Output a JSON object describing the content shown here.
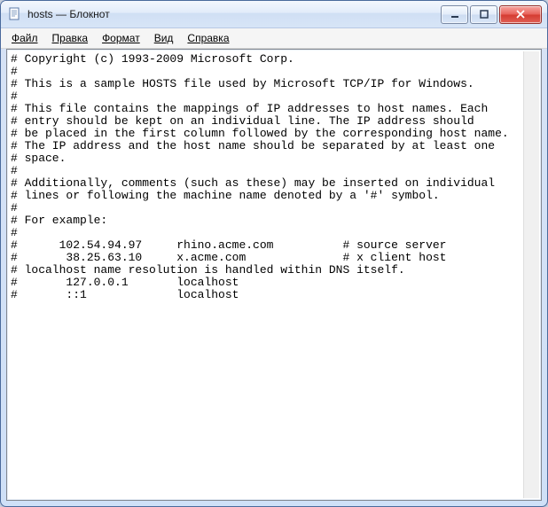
{
  "window": {
    "title": "hosts — Блокнот"
  },
  "menu": {
    "file": "Файл",
    "edit": "Правка",
    "format": "Формат",
    "view": "Вид",
    "help": "Справка"
  },
  "editor": {
    "content": "# Copyright (c) 1993-2009 Microsoft Corp.\n#\n# This is a sample HOSTS file used by Microsoft TCP/IP for Windows.\n#\n# This file contains the mappings of IP addresses to host names. Each\n# entry should be kept on an individual line. The IP address should\n# be placed in the first column followed by the corresponding host name.\n# The IP address and the host name should be separated by at least one\n# space.\n#\n# Additionally, comments (such as these) may be inserted on individual\n# lines or following the machine name denoted by a '#' symbol.\n#\n# For example:\n#\n#      102.54.94.97     rhino.acme.com          # source server\n#       38.25.63.10     x.acme.com              # x client host\n# localhost name resolution is handled within DNS itself.\n#       127.0.0.1       localhost\n#       ::1             localhost"
  },
  "controls": {
    "minimize": "minimize",
    "maximize": "maximize",
    "close": "close"
  }
}
